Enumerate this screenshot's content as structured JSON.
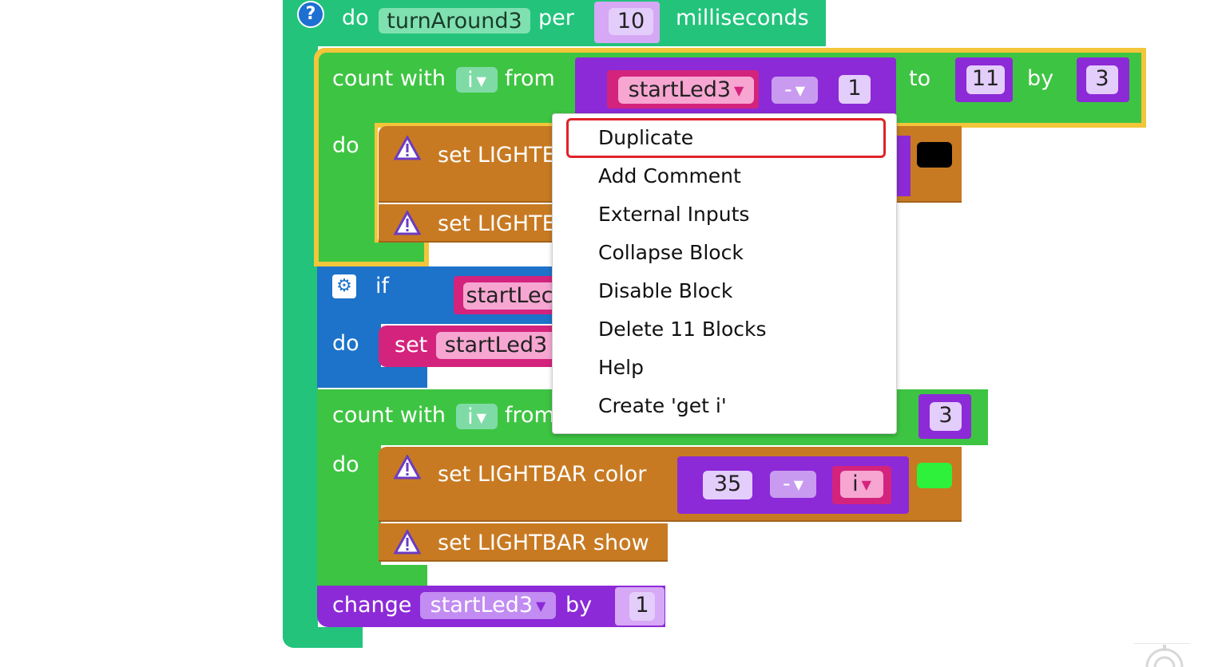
{
  "help_badge": "?",
  "top_block": {
    "do_label": "do",
    "procedure_name": "turnAround3",
    "per_label": "per",
    "interval_value": "10",
    "unit_label": "milliseconds"
  },
  "count_loop_1": {
    "count_label": "count with",
    "variable": "i",
    "from_label": "from",
    "start_var": "startLed3",
    "operator": "-",
    "subtract_value": "1",
    "to_label": "to",
    "to_value": "11",
    "by_label": "by",
    "by_value": "3",
    "do_label": "do",
    "stmt1_label": "set LIGHTE",
    "stmt2_label": "set LIGHTE",
    "color_swatch": "#000000"
  },
  "if_block": {
    "if_label": "if",
    "condition_var": "startLec",
    "do_label": "do",
    "set_label": "set",
    "set_var": "startLed3"
  },
  "count_loop_2": {
    "count_label": "count with",
    "variable": "i",
    "from_label": "from",
    "by_value": "3",
    "do_label": "do",
    "stmt1_label": "set LIGHTBAR color",
    "color_base": "35",
    "operator": "-",
    "operand_var": "i",
    "color_swatch": "#2ef13b",
    "stmt2_label": "set LIGHTBAR show"
  },
  "change_block": {
    "change_label": "change",
    "variable": "startLed3",
    "by_label": "by",
    "value": "1"
  },
  "context_menu": {
    "items": [
      "Duplicate",
      "Add Comment",
      "External Inputs",
      "Collapse Block",
      "Disable Block",
      "Delete 11 Blocks",
      "Help",
      "Create 'get i'"
    ],
    "highlighted": "Duplicate",
    "highlight_color": "#e0222a"
  },
  "colors": {
    "procedure": "#23c37c",
    "loop": "#3ec443",
    "loop_selected_outline": "#f3c53a",
    "action": "#c87a22",
    "logic": "#1d72c9",
    "math": "#8c2ad7",
    "variable": "#d4237d"
  }
}
